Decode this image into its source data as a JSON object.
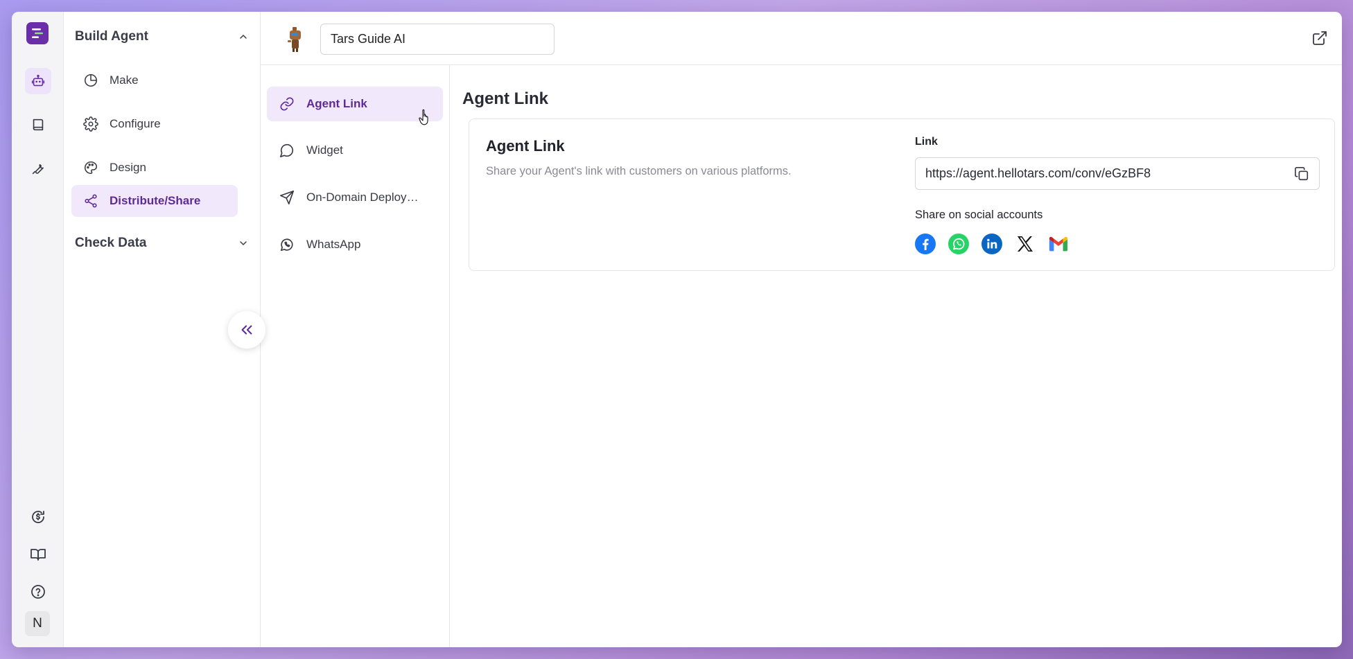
{
  "sidebar": {
    "build_agent": {
      "title": "Build Agent",
      "items": [
        {
          "label": "Make"
        },
        {
          "label": "Configure"
        },
        {
          "label": "Design"
        },
        {
          "label": "Distribute/Share"
        }
      ]
    },
    "check_data": {
      "title": "Check Data"
    }
  },
  "rail": {
    "avatar_initial": "N"
  },
  "header": {
    "agent_name": "Tars Guide AI"
  },
  "subnav": {
    "items": [
      {
        "label": "Agent Link"
      },
      {
        "label": "Widget"
      },
      {
        "label": "On-Domain Deployment"
      },
      {
        "label": "WhatsApp"
      }
    ]
  },
  "main": {
    "page_title": "Agent Link",
    "card": {
      "title": "Agent Link",
      "description": "Share your Agent's link with customers on various platforms.",
      "link_label": "Link",
      "link_value": "https://agent.hellotars.com/conv/eGzBF8",
      "share_label": "Share on social accounts",
      "socials": [
        "facebook-icon",
        "whatsapp-icon",
        "linkedin-icon",
        "x-icon",
        "gmail-icon"
      ]
    }
  },
  "colors": {
    "accent": "#6a2fa8",
    "active_bg": "#f1e9fb",
    "active_text": "#5e2a98"
  }
}
